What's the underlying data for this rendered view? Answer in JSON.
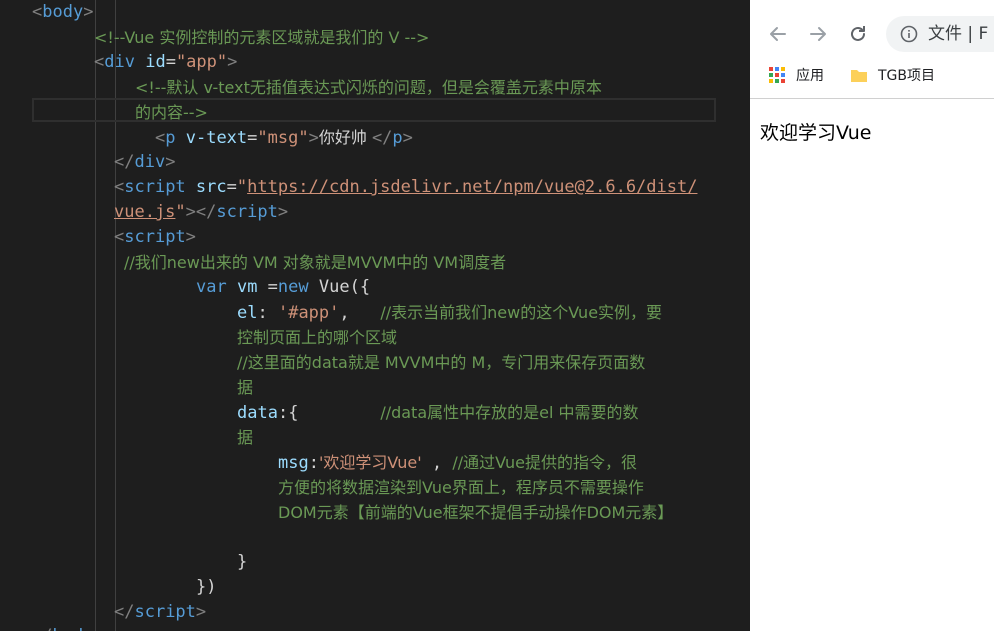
{
  "editor": {
    "lines": [
      [
        {
          "t": "<",
          "c": "punc"
        },
        {
          "t": "body",
          "c": "tag"
        },
        {
          "t": ">",
          "c": "punc"
        }
      ],
      [
        {
          "t": "<!--Vue 实例控制的元素区域就是我们的 V -->",
          "c": "cmt"
        }
      ],
      [
        {
          "t": "<",
          "c": "punc"
        },
        {
          "t": "div",
          "c": "tag"
        },
        {
          "t": " id",
          "c": "attr"
        },
        {
          "t": "=",
          "c": "fn"
        },
        {
          "t": "\"app\"",
          "c": "str"
        },
        {
          "t": ">",
          "c": "punc"
        }
      ],
      [
        {
          "t": "<!--默认 v-text无插值表达式闪烁的问题，但是会覆盖元素中原本",
          "c": "cmt"
        }
      ],
      [
        {
          "t": "的内容-->",
          "c": "cmt"
        }
      ],
      [
        {
          "t": "<",
          "c": "punc"
        },
        {
          "t": "p",
          "c": "tag"
        },
        {
          "t": " v-text",
          "c": "attr"
        },
        {
          "t": "=",
          "c": "fn"
        },
        {
          "t": "\"msg\"",
          "c": "str"
        },
        {
          "t": ">",
          "c": "punc"
        },
        {
          "t": "你好帅 ",
          "c": "fn"
        },
        {
          "t": "</",
          "c": "punc"
        },
        {
          "t": "p",
          "c": "tag"
        },
        {
          "t": ">",
          "c": "punc"
        }
      ],
      [
        {
          "t": "</",
          "c": "punc"
        },
        {
          "t": "div",
          "c": "tag"
        },
        {
          "t": ">",
          "c": "punc"
        }
      ],
      [
        {
          "t": "<",
          "c": "punc"
        },
        {
          "t": "script",
          "c": "tag"
        },
        {
          "t": " src",
          "c": "attr"
        },
        {
          "t": "=",
          "c": "fn"
        },
        {
          "t": "\"",
          "c": "str"
        },
        {
          "t": "https://cdn.jsdelivr.net/npm/vue@2.6.6/dist/",
          "c": "url"
        }
      ],
      [
        {
          "t": "vue.js",
          "c": "url"
        },
        {
          "t": "\"",
          "c": "str"
        },
        {
          "t": "></",
          "c": "punc"
        },
        {
          "t": "script",
          "c": "tag"
        },
        {
          "t": ">",
          "c": "punc"
        }
      ],
      [
        {
          "t": "<",
          "c": "punc"
        },
        {
          "t": "script",
          "c": "tag"
        },
        {
          "t": ">",
          "c": "punc"
        }
      ],
      [
        {
          "t": "//我们new出来的 VM 对象就是MVVM中的 VM调度者",
          "c": "cmt"
        }
      ],
      [
        {
          "t": "var",
          "c": "kw"
        },
        {
          "t": " vm ",
          "c": "var"
        },
        {
          "t": "=",
          "c": "fn"
        },
        {
          "t": "new",
          "c": "kw"
        },
        {
          "t": " Vue({",
          "c": "fn"
        }
      ],
      [
        {
          "t": "el",
          "c": "var"
        },
        {
          "t": ": ",
          "c": "fn"
        },
        {
          "t": "'#app'",
          "c": "str"
        },
        {
          "t": ",   ",
          "c": "fn"
        },
        {
          "t": "//表示当前我们new的这个Vue实例，要",
          "c": "cmt"
        }
      ],
      [
        {
          "t": "控制页面上的哪个区域",
          "c": "cmt"
        }
      ],
      [
        {
          "t": "//这里面的data就是 MVVM中的 M，专门用来保存页面数",
          "c": "cmt"
        }
      ],
      [
        {
          "t": "据",
          "c": "cmt"
        }
      ],
      [
        {
          "t": "data",
          "c": "var"
        },
        {
          "t": ":{        ",
          "c": "fn"
        },
        {
          "t": "//data属性中存放的是el 中需要的数",
          "c": "cmt"
        }
      ],
      [
        {
          "t": "据",
          "c": "cmt"
        }
      ],
      [
        {
          "t": "msg",
          "c": "var"
        },
        {
          "t": ":",
          "c": "fn"
        },
        {
          "t": "'欢迎学习Vue'",
          "c": "str"
        },
        {
          "t": " , ",
          "c": "fn"
        },
        {
          "t": "//通过Vue提供的指令，很",
          "c": "cmt"
        }
      ],
      [
        {
          "t": "方便的将数据渲染到Vue界面上，程序员不需要操作",
          "c": "cmt"
        }
      ],
      [
        {
          "t": "DOM元素【前端的Vue框架不提倡手动操作DOM元素】",
          "c": "cmt"
        }
      ],
      [],
      [
        {
          "t": "}",
          "c": "fn"
        }
      ],
      [
        {
          "t": "})",
          "c": "fn"
        }
      ],
      [
        {
          "t": "</",
          "c": "punc"
        },
        {
          "t": "script",
          "c": "tag"
        },
        {
          "t": ">",
          "c": "punc"
        }
      ],
      [
        {
          "t": "</",
          "c": "punc"
        },
        {
          "t": "body",
          "c": "tag"
        },
        {
          "t": ">",
          "c": "punc"
        }
      ]
    ]
  },
  "browser": {
    "address_text": "文件 | F",
    "bookmarks": [
      {
        "label": "应用",
        "icon": "apps-grid-icon"
      },
      {
        "label": "TGB项目",
        "icon": "folder-icon"
      }
    ],
    "page_text": "欢迎学习Vue"
  }
}
